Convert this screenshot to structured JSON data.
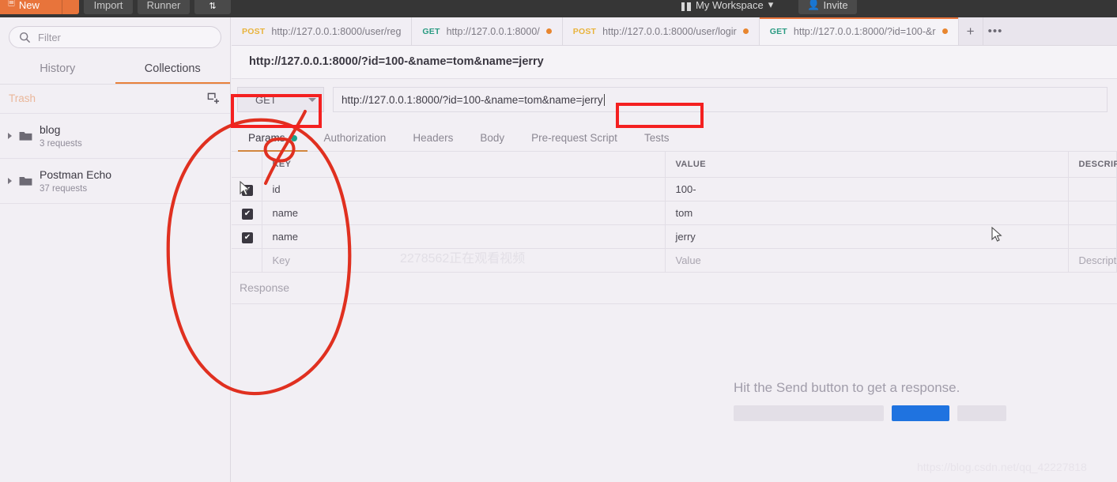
{
  "topbar": {
    "new_label": "New",
    "import_label": "Import",
    "runner_label": "Runner",
    "workspace_label": "My Workspace",
    "invite_label": "Invite"
  },
  "sidebar": {
    "filter_placeholder": "Filter",
    "tabs": [
      {
        "label": "History",
        "active": false
      },
      {
        "label": "Collections",
        "active": true
      }
    ],
    "trash_label": "Trash",
    "collections": [
      {
        "name": "blog",
        "sub": "3 requests"
      },
      {
        "name": "Postman Echo",
        "sub": "37 requests"
      }
    ]
  },
  "request_tabs": [
    {
      "method": "POST",
      "url": "http://127.0.0.1:8000/user/reg",
      "unsaved": false,
      "active": false
    },
    {
      "method": "GET",
      "url": "http://127.0.0.1:8000/",
      "unsaved": true,
      "active": false
    },
    {
      "method": "POST",
      "url": "http://127.0.0.1:8000/user/logir",
      "unsaved": true,
      "active": false
    },
    {
      "method": "GET",
      "url": "http://127.0.0.1:8000/?id=100-&r",
      "unsaved": true,
      "active": true
    }
  ],
  "tabstrip_actions": {
    "add": "+",
    "more": "•••"
  },
  "request": {
    "title": "http://127.0.0.1:8000/?id=100-&name=tom&name=jerry",
    "method": "GET",
    "url": "http://127.0.0.1:8000/?id=100-&name=tom&name=jerry",
    "tabs": [
      {
        "label": "Params",
        "active": true,
        "dot": true
      },
      {
        "label": "Authorization",
        "active": false,
        "dot": false
      },
      {
        "label": "Headers",
        "active": false,
        "dot": false
      },
      {
        "label": "Body",
        "active": false,
        "dot": false
      },
      {
        "label": "Pre-request Script",
        "active": false,
        "dot": false
      },
      {
        "label": "Tests",
        "active": false,
        "dot": false
      }
    ],
    "params_headers": [
      "KEY",
      "VALUE",
      "DESCRIPTION"
    ],
    "params": [
      {
        "checked": true,
        "key": "id",
        "value": "100-",
        "description": ""
      },
      {
        "checked": true,
        "key": "name",
        "value": "tom",
        "description": ""
      },
      {
        "checked": true,
        "key": "name",
        "value": "jerry",
        "description": ""
      }
    ],
    "params_placeholder": {
      "key": "Key",
      "value": "Value",
      "description": "Description"
    }
  },
  "response": {
    "title": "Response",
    "hint": "Hit the Send button to get a response."
  },
  "watermarks": {
    "center": "2278562正在观看视频",
    "corner": "https://blog.csdn.net/qq_42227818"
  },
  "colors": {
    "accent_orange": "#e8743b",
    "verb_get": "#2a9b82",
    "verb_post": "#e8b33b",
    "annotation_red": "#f42020",
    "params_dot_green": "#1ba38b",
    "skeleton_blue": "#1f73e0"
  }
}
